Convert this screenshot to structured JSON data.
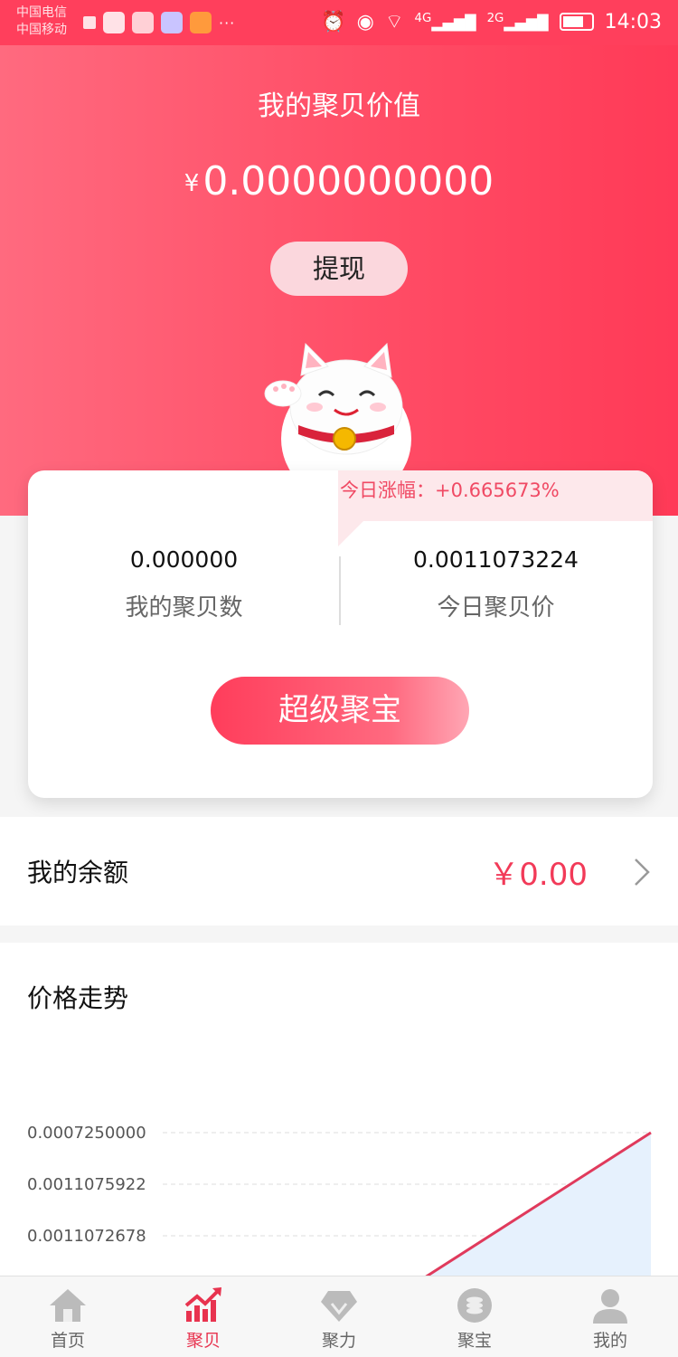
{
  "status_bar": {
    "carrier_1": "中国电信",
    "carrier_2": "中国移动",
    "network_1": "4G",
    "network_2": "2G",
    "time": "14:03"
  },
  "hero": {
    "title": "我的聚贝价值",
    "currency": "¥",
    "amount": "0.0000000000",
    "withdraw_label": "提现"
  },
  "card": {
    "rise_label": "今日涨幅：+0.665673%",
    "my_count_value": "0.000000",
    "my_count_label": "我的聚贝数",
    "price_value": "0.0011073224",
    "price_label": "今日聚贝价",
    "super_button": "超级聚宝"
  },
  "balance": {
    "label": "我的余额",
    "value": "￥0.00"
  },
  "trend": {
    "title": "价格走势"
  },
  "chart_data": {
    "type": "area",
    "y_tick_labels": [
      "0.0007250000",
      "0.0011075922",
      "0.0011072678"
    ],
    "grid": true,
    "colors": {
      "line": "#e03a5c",
      "fill": "#e6f1fd"
    }
  },
  "tabs": [
    {
      "label": "首页",
      "icon": "home-icon",
      "active": false
    },
    {
      "label": "聚贝",
      "icon": "trend-chart-icon",
      "active": true
    },
    {
      "label": "聚力",
      "icon": "diamond-icon",
      "active": false
    },
    {
      "label": "聚宝",
      "icon": "coin-stack-icon",
      "active": false
    },
    {
      "label": "我的",
      "icon": "user-icon",
      "active": false
    }
  ],
  "colors": {
    "brand": "#ff3f5c",
    "accent_text": "#f23a58"
  }
}
